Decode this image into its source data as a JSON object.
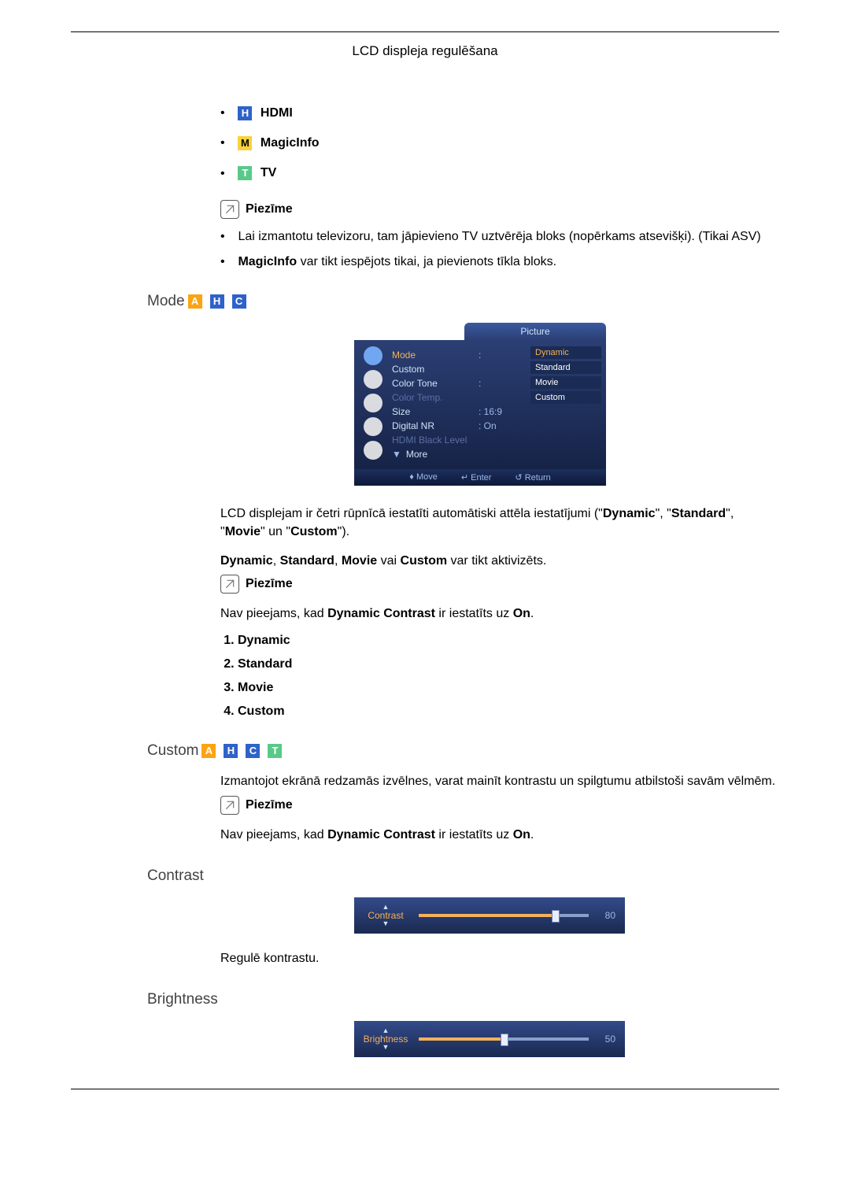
{
  "header": {
    "title": "LCD displeja regulēšana"
  },
  "inputs": {
    "hdmi": "HDMI",
    "magicinfo": "MagicInfo",
    "tv": "TV"
  },
  "note_label": "Piezīme",
  "notes_top": {
    "line1": "Lai izmantotu televizoru, tam jāpievieno TV uztvērēja bloks (nopērkams atsevišķi). (Tikai ASV)",
    "line2_prefix": "MagicInfo",
    "line2_rest": " var tikt iespējots tikai, ja pievienots tīkla bloks."
  },
  "mode": {
    "title": "Mode",
    "osd": {
      "tab": "Picture",
      "rows": {
        "mode": "Mode",
        "custom": "Custom",
        "color_tone": "Color Tone",
        "color_temp": "Color Temp.",
        "size": "Size",
        "size_val": "16:9",
        "dnr": "Digital NR",
        "dnr_val": "On",
        "hdmi_black": "HDMI Black Level",
        "more": "More"
      },
      "options": {
        "dynamic": "Dynamic",
        "standard": "Standard",
        "movie": "Movie",
        "custom": "Custom"
      },
      "foot": {
        "move": "Move",
        "enter": "Enter",
        "return": "Return"
      }
    },
    "para1_a": "LCD displejam ir četri rūpnīcā iestatīti automātiski attēla iestatījumi (\"",
    "para1_b": "Dynamic",
    "para1_c": "\", \"",
    "para1_d": "Standard",
    "para1_e": "\", \"",
    "para1_f": "Movie",
    "para1_g": "\" un \"",
    "para1_h": "Custom",
    "para1_i": "\").",
    "para2_a": "Dynamic",
    "para2_b": ", ",
    "para2_c": "Standard",
    "para2_d": ", ",
    "para2_e": "Movie",
    "para2_f": " vai ",
    "para2_g": "Custom",
    "para2_h": " var tikt aktivizēts.",
    "note_a": "Nav pieejams, kad ",
    "note_b": "Dynamic Contrast",
    "note_c": " ir iestatīts uz ",
    "note_d": "On",
    "note_e": ".",
    "list": {
      "i1": "Dynamic",
      "i2": "Standard",
      "i3": "Movie",
      "i4": "Custom"
    }
  },
  "custom": {
    "title": "Custom",
    "para": "Izmantojot ekrānā redzamās izvēlnes, varat mainīt kontrastu un spilgtumu atbilstoši savām vēlmēm.",
    "note_a": "Nav pieejams, kad ",
    "note_b": "Dynamic Contrast",
    "note_c": " ir iestatīts uz ",
    "note_d": "On",
    "note_e": "."
  },
  "contrast": {
    "title": "Contrast",
    "slider_label": "Contrast",
    "value": "80",
    "para": "Regulē kontrastu."
  },
  "brightness": {
    "title": "Brightness",
    "slider_label": "Brightness",
    "value": "50"
  },
  "chart_data": [
    {
      "type": "bar",
      "title": "Contrast",
      "categories": [
        "Contrast"
      ],
      "values": [
        80
      ],
      "xlabel": "",
      "ylabel": "",
      "ylim": [
        0,
        100
      ]
    },
    {
      "type": "bar",
      "title": "Brightness",
      "categories": [
        "Brightness"
      ],
      "values": [
        50
      ],
      "xlabel": "",
      "ylabel": "",
      "ylim": [
        0,
        100
      ]
    }
  ]
}
